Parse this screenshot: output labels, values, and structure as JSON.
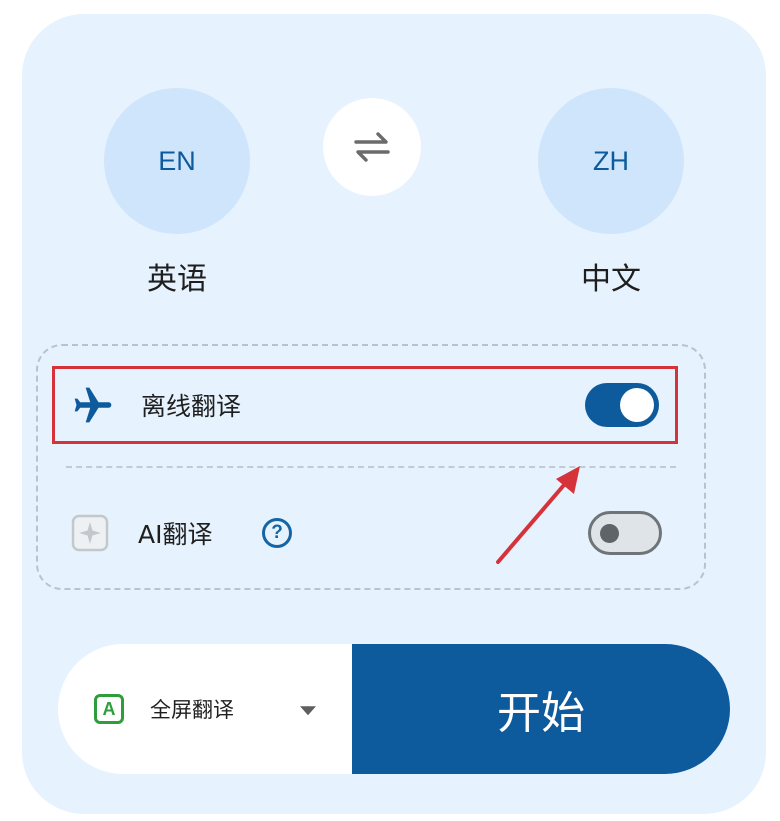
{
  "source_lang": {
    "code": "EN",
    "name": "英语"
  },
  "target_lang": {
    "code": "ZH",
    "name": "中文"
  },
  "swap_icon": "swap-arrows-icon",
  "options": {
    "offline": {
      "label": "离线翻译",
      "icon": "airplane-icon",
      "enabled": true
    },
    "ai": {
      "label": "AI翻译",
      "icon": "sparkle-icon",
      "help": "?",
      "enabled": false
    }
  },
  "mode": {
    "label": "全屏翻译",
    "icon_text": "A"
  },
  "start_label": "开始",
  "colors": {
    "primary": "#0d5a9c",
    "card_bg": "#e6f2fd",
    "lang_circle": "#cfe5fb",
    "highlight": "#d6323a",
    "mode_icon": "#2e9e3a"
  }
}
